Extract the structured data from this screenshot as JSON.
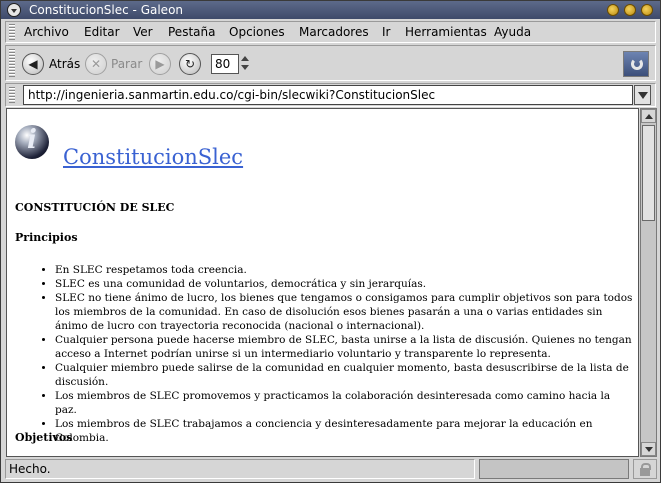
{
  "window": {
    "title": "ConstitucionSlec - Galeon"
  },
  "menubar": {
    "items": [
      "Archivo",
      "Editar",
      "Ver",
      "Pestaña",
      "Opciones",
      "Marcadores",
      "Ir",
      "Herramientas",
      "Ayuda"
    ]
  },
  "toolbar": {
    "back_label": "Atrás",
    "stop_label": "Parar",
    "zoom_value": "80"
  },
  "location": {
    "url": "http://ingenieria.sanmartin.edu.co/cgi-bin/slecwiki?ConstitucionSlec"
  },
  "page": {
    "title": "ConstitucionSlec",
    "heading": "CONSTITUCIÓN DE SLEC",
    "principios_heading": "Principios",
    "principios": [
      "En SLEC respetamos toda creencia.",
      "SLEC es una comunidad de voluntarios, democrática y sin jerarquías.",
      "SLEC no tiene ánimo de lucro, los bienes que tengamos o consigamos para cumplir objetivos son para todos los miembros de la comunidad. En caso de disolución esos bienes pasarán a una o varias entidades sin ánimo de lucro con trayectoria reconocida (nacional o internacional).",
      "Cualquier persona puede hacerse miembro de SLEC, basta unirse a la lista de discusión. Quienes no tengan acceso a Internet podrían unirse si un intermediario voluntario y transparente lo representa.",
      "Cualquier miembro puede salirse de la comunidad en cualquier momento, basta desuscribirse de la lista de discusión.",
      "Los miembros de SLEC promovemos y practicamos la colaboración desinteresada como camino hacia la paz.",
      "Los miembros de SLEC trabajamos a conciencia y desinteresadamente para mejorar la educación en Colombia."
    ],
    "objetivos_heading": "Objetivos"
  },
  "status": {
    "text": "Hecho."
  },
  "colors": {
    "title_link": "#3a62d2",
    "titlebar": "#4a5678"
  }
}
